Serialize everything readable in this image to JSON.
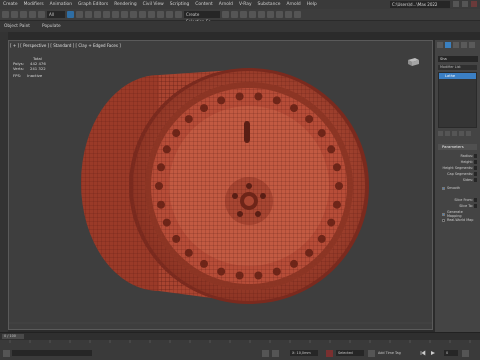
{
  "menubar": {
    "items": [
      "Create",
      "Modifiers",
      "Animation",
      "Graph Editors",
      "Rendering",
      "Civil View",
      "Scripting",
      "Content",
      "Arnold",
      "V-Ray",
      "Substance",
      "Arnold",
      "Help"
    ],
    "workspace": "C:\\Users\\d...\\Max 2022"
  },
  "toolbar": {
    "selection_filter": "All",
    "named_selection": "Create Selection Se"
  },
  "ribbon": {
    "items": [
      "Object Paint",
      "Populate"
    ]
  },
  "viewport": {
    "label": "[ + ] [ Perspective ] [ Standard ] [ Clay + Edged Faces ]",
    "stats": {
      "total_label": "Total",
      "polys_label": "Polys:",
      "polys_value": "442 476",
      "verts_label": "Verts:",
      "verts_value": "241 322",
      "fps_label": "FPS:",
      "fps_value": "Inactive"
    }
  },
  "command_panel": {
    "name_value": "Sha",
    "modifier_list_label": "Modifier List",
    "modifier_item": "Lathe",
    "rollout_title": "Parameters",
    "params": [
      "Radius:",
      "Height:",
      "Height Segments:",
      "Cap Segments:",
      "Sides:"
    ],
    "smooth": "Smooth",
    "slice_from": "Slice From:",
    "slice_to": "Slice To:",
    "generate_mapping": "Generate Mapping",
    "real_world_map": "Real-World Map"
  },
  "timeline": {
    "frame_counter": "0 / 100"
  },
  "status": {
    "x_value": "X: 10,0mm",
    "selected": "Selected",
    "add_time_tag": "Add Time Tag",
    "frame": "0"
  },
  "colors": {
    "wheel": "#b34a35",
    "wheel_dark": "#7a2a1e",
    "viewport_bg": "#3e3e3e",
    "accent": "#3b7fc4"
  }
}
